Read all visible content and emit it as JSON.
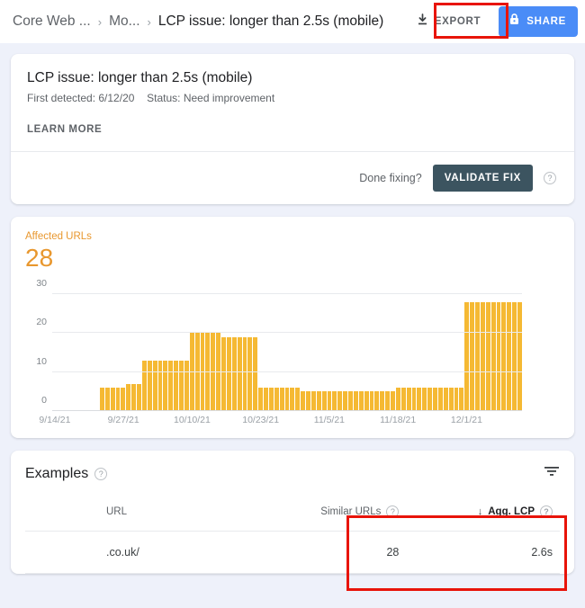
{
  "header": {
    "breadcrumb": [
      {
        "label": "Core Web ...",
        "current": false
      },
      {
        "label": "Mo...",
        "current": false
      },
      {
        "label": "LCP issue: longer than 2.5s (mobile)",
        "current": true
      }
    ],
    "separator": "›",
    "export_label": "EXPORT",
    "export_icon": "download-icon",
    "share_label": "SHARE",
    "share_icon": "lock-icon"
  },
  "issue": {
    "title": "LCP issue: longer than 2.5s (mobile)",
    "first_detected_label": "First detected:",
    "first_detected_value": "6/12/20",
    "status_label": "Status:",
    "status_value": "Need improvement",
    "learn_more": "LEARN MORE",
    "done_fixing": "Done fixing?",
    "validate_label": "VALIDATE FIX",
    "help": "?"
  },
  "affected": {
    "label": "Affected URLs",
    "value": "28",
    "color": "#e8972e"
  },
  "examples": {
    "title": "Examples",
    "help": "?",
    "filter_icon": "filter-icon",
    "columns": {
      "url": "URL",
      "similar": "Similar URLs",
      "agg_lcp": "Agg. LCP",
      "sort_arrow": "↓"
    },
    "rows": [
      {
        "url": ".co.uk/",
        "similar": "28",
        "agg_lcp": "2.6s"
      }
    ]
  },
  "chart_data": {
    "type": "bar",
    "title": "Affected URLs",
    "xlabel": "",
    "ylabel": "",
    "ylim": [
      0,
      30
    ],
    "yticks": [
      0,
      10,
      20,
      30
    ],
    "grid": true,
    "bar_color": "#f5b933",
    "xtick_labels": [
      "9/14/21",
      "9/27/21",
      "10/10/21",
      "10/23/21",
      "11/5/21",
      "11/18/21",
      "12/1/21"
    ],
    "xtick_indices": [
      0,
      13,
      26,
      39,
      52,
      65,
      78
    ],
    "categories": [
      "9/14/21",
      "9/15/21",
      "9/16/21",
      "9/17/21",
      "9/18/21",
      "9/19/21",
      "9/20/21",
      "9/21/21",
      "9/22/21",
      "9/23/21",
      "9/24/21",
      "9/25/21",
      "9/26/21",
      "9/27/21",
      "9/28/21",
      "9/29/21",
      "9/30/21",
      "10/1/21",
      "10/2/21",
      "10/3/21",
      "10/4/21",
      "10/5/21",
      "10/6/21",
      "10/7/21",
      "10/8/21",
      "10/9/21",
      "10/10/21",
      "10/11/21",
      "10/12/21",
      "10/13/21",
      "10/14/21",
      "10/15/21",
      "10/16/21",
      "10/17/21",
      "10/18/21",
      "10/19/21",
      "10/20/21",
      "10/21/21",
      "10/22/21",
      "10/23/21",
      "10/24/21",
      "10/25/21",
      "10/26/21",
      "10/27/21",
      "10/28/21",
      "10/29/21",
      "10/30/21",
      "10/31/21",
      "11/1/21",
      "11/2/21",
      "11/3/21",
      "11/4/21",
      "11/5/21",
      "11/6/21",
      "11/7/21",
      "11/8/21",
      "11/9/21",
      "11/10/21",
      "11/11/21",
      "11/12/21",
      "11/13/21",
      "11/14/21",
      "11/15/21",
      "11/16/21",
      "11/17/21",
      "11/18/21",
      "11/19/21",
      "11/20/21",
      "11/21/21",
      "11/22/21",
      "11/23/21",
      "11/24/21",
      "11/25/21",
      "11/26/21",
      "11/27/21",
      "11/28/21",
      "11/29/21",
      "11/30/21",
      "12/1/21",
      "12/2/21",
      "12/3/21",
      "12/4/21",
      "12/5/21",
      "12/6/21",
      "12/7/21",
      "12/8/21",
      "12/9/21"
    ],
    "values": [
      0,
      0,
      0,
      0,
      0,
      0,
      0,
      0,
      0,
      6,
      6,
      6,
      6,
      6,
      7,
      7,
      7,
      13,
      13,
      13,
      13,
      13,
      13,
      13,
      13,
      13,
      20,
      20,
      20,
      20,
      20,
      20,
      19,
      19,
      19,
      19,
      19,
      19,
      19,
      6,
      6,
      6,
      6,
      6,
      6,
      6,
      6,
      5,
      5,
      5,
      5,
      5,
      5,
      5,
      5,
      5,
      5,
      5,
      5,
      5,
      5,
      5,
      5,
      5,
      5,
      6,
      6,
      6,
      6,
      6,
      6,
      6,
      6,
      6,
      6,
      6,
      6,
      6,
      28,
      28,
      28,
      28,
      28,
      28,
      28,
      28,
      28,
      28,
      28
    ]
  }
}
